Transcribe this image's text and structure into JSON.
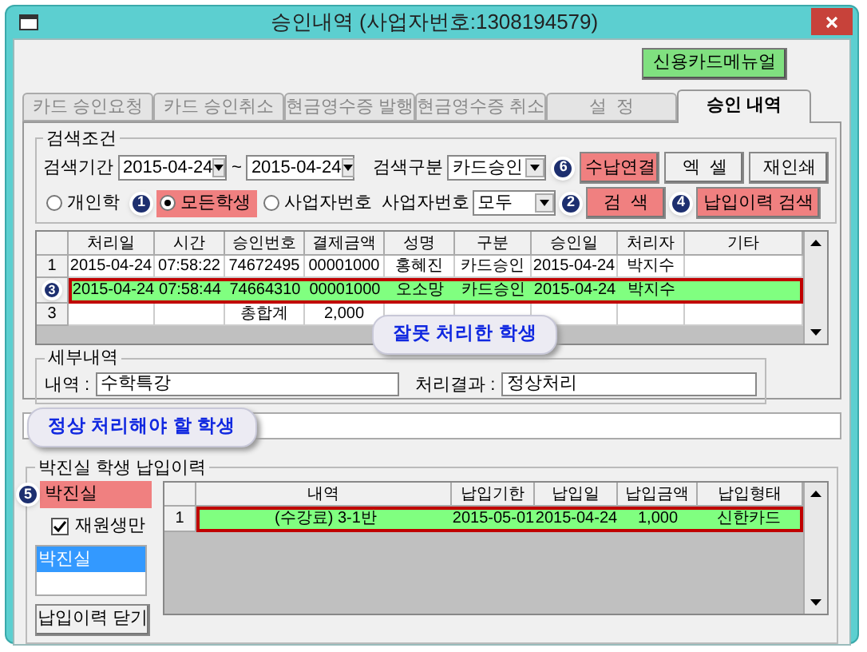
{
  "window": {
    "title": "승인내역 (사업자번호:1308194579)"
  },
  "manual_button": {
    "label": "신용카드메뉴얼"
  },
  "tabs": [
    {
      "label": "카드 승인요청",
      "selected": false
    },
    {
      "label": "카드 승인취소",
      "selected": false
    },
    {
      "label": "현금영수증 발행",
      "selected": false
    },
    {
      "label": "현금영수증 취소",
      "selected": false
    },
    {
      "label": "설  정",
      "selected": false
    },
    {
      "label": "승인 내역",
      "selected": true
    }
  ],
  "search": {
    "title": "검색조건",
    "period_label": "검색기간",
    "date_from": "2015-04-24",
    "tilde": "~",
    "date_to": "2015-04-24",
    "kind_label": "검색구분",
    "kind_value": "카드승인",
    "bizno_label": "사업자번호",
    "bizno_value": "모두",
    "radios": [
      {
        "label": "개인학",
        "selected": false,
        "highlighted": false
      },
      {
        "label": "모든학생",
        "selected": true,
        "highlighted": true,
        "marker": "1"
      },
      {
        "label": "사업자번호",
        "selected": false,
        "highlighted": false
      }
    ],
    "buttons_top": [
      {
        "label": "수납연결",
        "highlighted": true,
        "marker": "6"
      },
      {
        "label": "엑  셀",
        "highlighted": false
      },
      {
        "label": "재인쇄",
        "highlighted": false
      }
    ],
    "buttons_bottom": [
      {
        "label": "검  색",
        "highlighted": true,
        "marker": "2"
      },
      {
        "label": "납입이력 검색",
        "highlighted": true,
        "marker": "4"
      }
    ]
  },
  "table": {
    "columns": [
      "처리일",
      "시간",
      "승인번호",
      "결제금액",
      "성명",
      "구분",
      "승인일",
      "처리자",
      "기타"
    ],
    "rows": [
      {
        "header": "1",
        "highlighted": false,
        "cells": [
          "2015-04-24",
          "07:58:22",
          "74672495",
          "00001000",
          "홍혜진",
          "카드승인",
          "2015-04-24",
          "박지수",
          ""
        ]
      },
      {
        "marker": "3",
        "highlighted": true,
        "cells": [
          "2015-04-24",
          "07:58:44",
          "74664310",
          "00001000",
          "오소망",
          "카드승인",
          "2015-04-24",
          "박지수",
          ""
        ]
      },
      {
        "header": "3",
        "highlighted": false,
        "cells": [
          "",
          "",
          "총합계",
          "2,000",
          "",
          "",
          "",
          "",
          ""
        ]
      }
    ]
  },
  "callout_wrong": "잘못 처리한 학생",
  "detail": {
    "title": "세부내역",
    "content_label": "내역 :",
    "content_value": "수학특강",
    "result_label": "처리결과 :",
    "result_value": "정상처리"
  },
  "callout_right": "정상 처리해야 할 학생",
  "history": {
    "title": "박진실 학생 납입이력",
    "name_value": "박진실",
    "name_marker": "5",
    "checkbox": {
      "label": "재원생만",
      "checked": true
    },
    "list": [
      {
        "label": "박진실",
        "selected": true
      }
    ],
    "close_button": "납입이력 닫기",
    "columns": [
      "내역",
      "납입기한",
      "납입일",
      "납입금액",
      "납입형태"
    ],
    "rows": [
      {
        "header": "1",
        "highlighted": true,
        "cells": [
          "(수강료) 3-1반",
          "2015-05-01",
          "2015-04-24",
          "1,000",
          "신한카드"
        ]
      }
    ]
  }
}
